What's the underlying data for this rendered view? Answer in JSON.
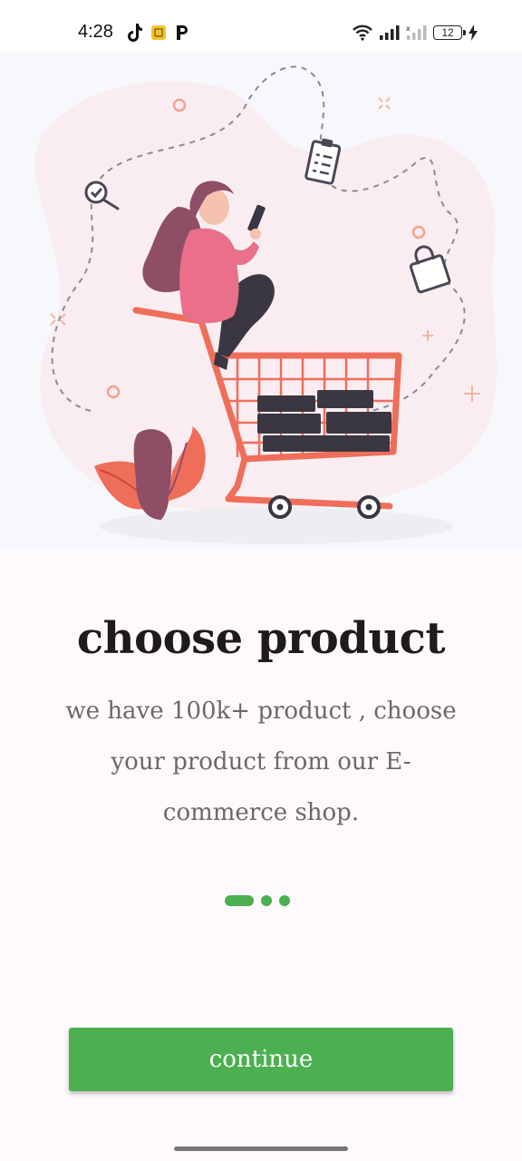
{
  "status_bar": {
    "time": "4:28",
    "battery_level": "12",
    "icons": [
      "tiktok-icon",
      "app-notification-icon",
      "p-app-icon",
      "wifi-icon",
      "signal-icon",
      "signal-no-data-icon",
      "battery-icon",
      "charging-icon"
    ]
  },
  "hero": {
    "illustration": "woman-riding-shopping-cart-illustration"
  },
  "onboarding": {
    "title": "choose product",
    "description": "we have 100k+ product , choose your product from our E-commerce shop.",
    "page_index": 1,
    "page_count": 3
  },
  "actions": {
    "continue_label": "continue"
  },
  "colors": {
    "accent": "#4caf50",
    "illustration_coral": "#ef6e5a",
    "illustration_pink": "#ea6f8a",
    "illustration_hair": "#8e4e66",
    "illustration_dark": "#3b3742"
  }
}
